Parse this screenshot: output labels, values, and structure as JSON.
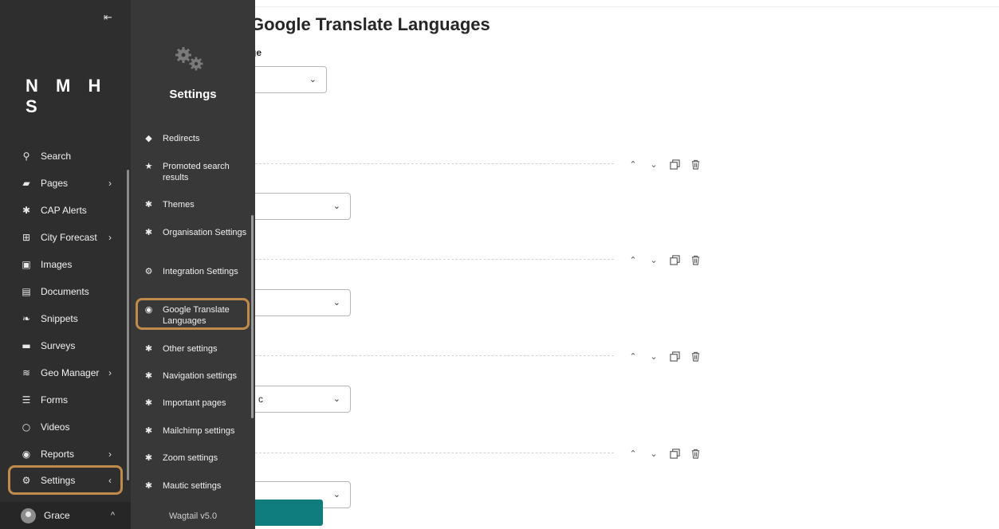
{
  "sidebar": {
    "collapse_icon": "collapse-left-icon",
    "brand": "N M H S",
    "items": [
      {
        "label": "Search",
        "icon": "search-icon",
        "glyph": "⚲",
        "has_arrow": false
      },
      {
        "label": "Pages",
        "icon": "folder-icon",
        "glyph": "▰",
        "has_arrow": true
      },
      {
        "label": "CAP Alerts",
        "icon": "cog-icon",
        "glyph": "✱",
        "has_arrow": false
      },
      {
        "label": "City Forecast",
        "icon": "table-icon",
        "glyph": "⊞",
        "has_arrow": true
      },
      {
        "label": "Images",
        "icon": "image-icon",
        "glyph": "▣",
        "has_arrow": false
      },
      {
        "label": "Documents",
        "icon": "document-icon",
        "glyph": "▤",
        "has_arrow": false
      },
      {
        "label": "Snippets",
        "icon": "leaf-icon",
        "glyph": "❧",
        "has_arrow": false
      },
      {
        "label": "Surveys",
        "icon": "folder-icon",
        "glyph": "▬",
        "has_arrow": false
      },
      {
        "label": "Geo Manager",
        "icon": "layers-icon",
        "glyph": "≋",
        "has_arrow": true
      },
      {
        "label": "Forms",
        "icon": "list-icon",
        "glyph": "☰",
        "has_arrow": false
      },
      {
        "label": "Videos",
        "icon": "circle-icon",
        "glyph": "○",
        "has_arrow": false
      },
      {
        "label": "Reports",
        "icon": "globe-icon",
        "glyph": "◉",
        "has_arrow": true
      },
      {
        "label": "Settings",
        "icon": "gears-icon",
        "glyph": "⚙",
        "has_arrow": true,
        "arrow": "‹"
      }
    ],
    "arrow_glyph": "›",
    "user": {
      "name": "Grace",
      "arrow": "^"
    }
  },
  "submenu": {
    "title": "Settings",
    "items": [
      {
        "label": "Redirects",
        "icon": "redirect-icon",
        "glyph": "◆"
      },
      {
        "label": "Promoted search results",
        "icon": "star-icon",
        "glyph": "★"
      },
      {
        "label": "Themes",
        "icon": "cog-icon",
        "glyph": "✱"
      },
      {
        "label": "Organisation Settings",
        "icon": "cog-icon",
        "glyph": "✱"
      },
      {
        "label": "Integration Settings",
        "icon": "gears-icon",
        "glyph": "⚙"
      },
      {
        "label": "Google Translate Languages",
        "icon": "globe-icon",
        "glyph": "◉"
      },
      {
        "label": "Other settings",
        "icon": "cog-icon",
        "glyph": "✱"
      },
      {
        "label": "Navigation settings",
        "icon": "cog-icon",
        "glyph": "✱"
      },
      {
        "label": "Important pages",
        "icon": "cog-icon",
        "glyph": "✱"
      },
      {
        "label": "Mailchimp settings",
        "icon": "cog-icon",
        "glyph": "✱"
      },
      {
        "label": "Zoom settings",
        "icon": "cog-icon",
        "glyph": "✱"
      },
      {
        "label": "Mautic settings",
        "icon": "cog-icon",
        "glyph": "✱"
      }
    ],
    "footer": "Wagtail v5.0"
  },
  "main": {
    "title": "Google Translate Languages",
    "default_language_label": "ge",
    "block_values": [
      "",
      "",
      "c",
      ""
    ]
  },
  "colors": {
    "sidebar_bg": "#2e2e2e",
    "submenu_bg": "#383838",
    "highlight": "#c08a4a",
    "save_button": "#0f7c7d"
  }
}
